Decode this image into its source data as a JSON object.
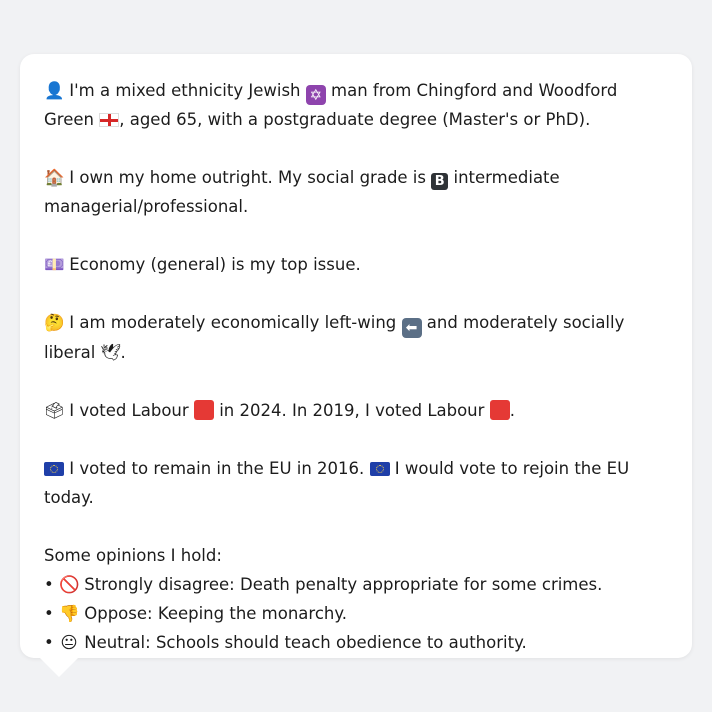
{
  "profile": {
    "intro_pre": "I'm a mixed ethnicity Jewish",
    "intro_mid": "man from Chingford and Woodford Green",
    "intro_post": ", aged 65, with a postgraduate degree (Master's or PhD).",
    "home_pre": "I own my home outright. My social grade is",
    "home_post": "intermediate managerial/professional.",
    "grade_letter": "B",
    "issue": "Economy (general) is my top issue.",
    "stance_pre": "I am moderately economically left-wing",
    "stance_mid": "and moderately socially liberal",
    "stance_post": ".",
    "vote_pre": "I voted Labour",
    "vote_mid": "in 2024. In 2019, I voted Labour",
    "vote_post": ".",
    "eu_1": "I voted to remain in the EU in 2016.",
    "eu_2": "I would vote to rejoin the EU today.",
    "opinions_title": "Some opinions I hold:",
    "opinions": [
      {
        "emoji": "🚫",
        "text": "Strongly disagree: Death penalty appropriate for some crimes."
      },
      {
        "emoji": "👎",
        "text": "Oppose: Keeping the monarchy."
      },
      {
        "emoji": "😐",
        "text": "Neutral: Schools should teach obedience to authority."
      }
    ],
    "bullet": "•"
  },
  "emoji": {
    "person": "👤",
    "star": "✡",
    "home": "🏠",
    "issue": "💷",
    "thinking": "🤔",
    "arrow": "⬅",
    "dove": "🕊",
    "ballot": "🗳"
  },
  "colors": {
    "background": "#f1f2f4",
    "bubble": "#ffffff",
    "labour_red": "#e53935",
    "eu_blue": "#1f3fa8"
  }
}
